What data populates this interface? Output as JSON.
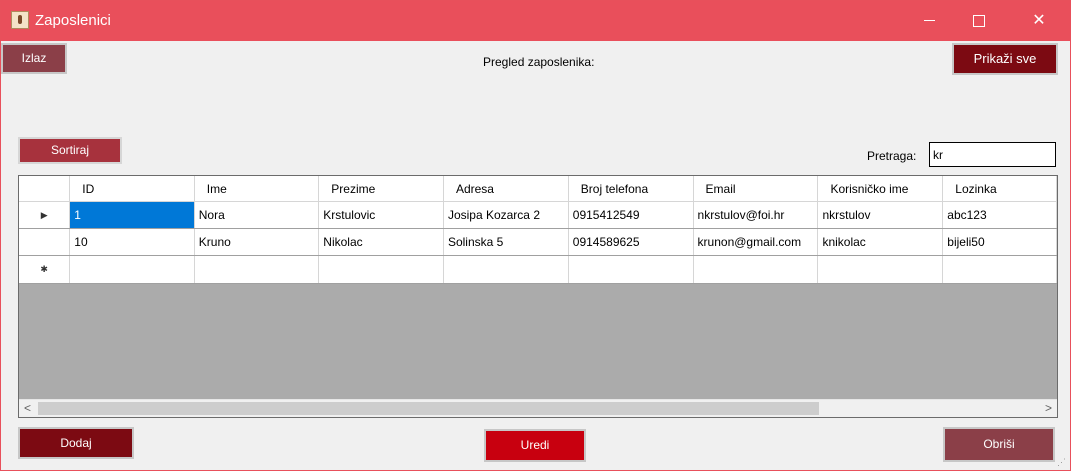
{
  "window": {
    "title": "Zaposlenici",
    "minimize_label": "—",
    "maximize_label": "☐",
    "close_label": "✕"
  },
  "toolbar": {
    "exit_label": "Izlaz",
    "show_all_label": "Prikaži sve",
    "sort_label": "Sortiraj"
  },
  "heading": "Pregled zaposlenika:",
  "search": {
    "label": "Pretraga:",
    "value": "kr"
  },
  "grid": {
    "columns": [
      "ID",
      "Ime",
      "Prezime",
      "Adresa",
      "Broj telefona",
      "Email",
      "Korisničko ime",
      "Lozinka"
    ],
    "rows": [
      {
        "id": "1",
        "ime": "Nora",
        "prezime": "Krstulovic",
        "adresa": "Josipa Kozarca 2",
        "telefon": "0915412549",
        "email": "nkrstulov@foi.hr",
        "korisnicko": "nkrstulov",
        "lozinka": "abc123"
      },
      {
        "id": "10",
        "ime": "Kruno",
        "prezime": "Nikolac",
        "adresa": "Solinska 5",
        "telefon": "0914589625",
        "email": "krunon@gmail.com",
        "korisnicko": "knikolac",
        "lozinka": "bijeli50"
      }
    ],
    "current_row_glyph": "▶",
    "new_row_glyph": "✱",
    "selection_color": "#0078d7"
  },
  "actions": {
    "add_label": "Dodaj",
    "edit_label": "Uredi",
    "delete_label": "Obriši"
  },
  "scrollbar": {
    "left_arrow": "<",
    "right_arrow": ">"
  },
  "colors": {
    "titlebar": "#e94f5b",
    "dark_red": "#7c0a12",
    "muted_red": "#8b3f48",
    "bright_red": "#c8000f"
  },
  "icons": {
    "app": "app-icon",
    "grip": "resize-grip-icon"
  }
}
